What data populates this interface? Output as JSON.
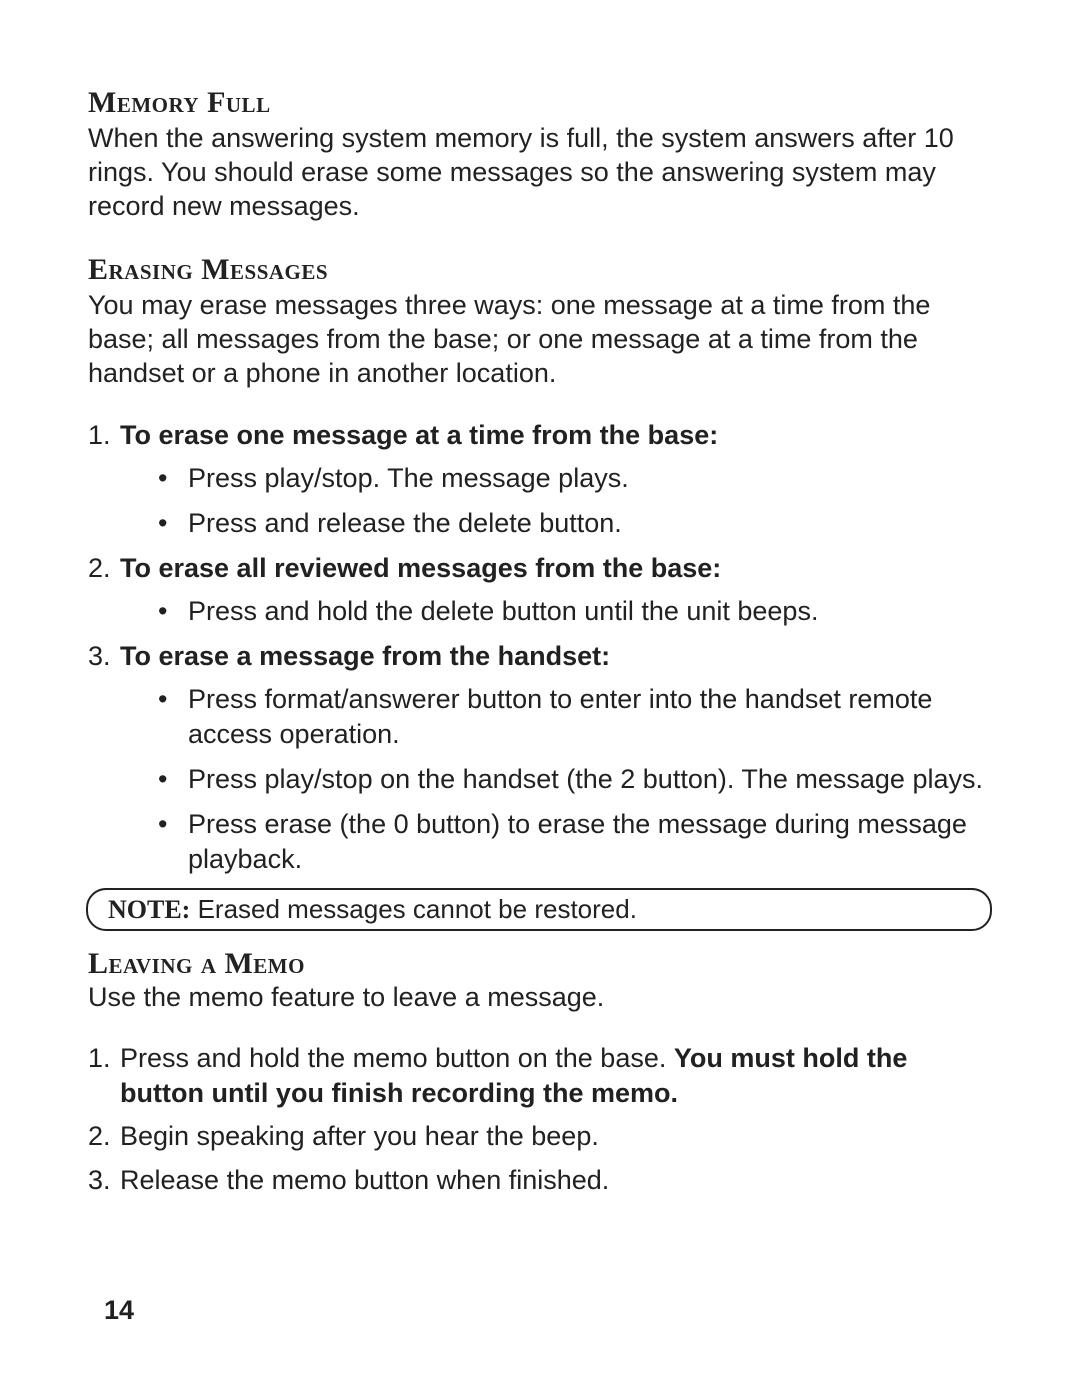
{
  "section1": {
    "heading": "Memory Full",
    "body": "When the answering system memory is full, the system answers after 10 rings. You should erase some messages so the answering system may record new messages."
  },
  "section2": {
    "heading": "Erasing Messages",
    "body": "You may erase messages three ways: one message at a time from the base; all messages from the base; or one message at a time from the handset or a phone in another location.",
    "items": [
      {
        "title": "To erase one message at a time from the base:",
        "bullets": [
          "Press play/stop. The message plays.",
          "Press and release the delete button."
        ]
      },
      {
        "title": "To erase all reviewed messages from the base:",
        "bullets": [
          "Press and hold the delete button until the unit beeps."
        ]
      },
      {
        "title": "To erase a message from the handset:",
        "bullets": [
          "Press format/answerer button to enter into the handset remote access operation.",
          "Press play/stop on the handset (the 2 button). The message plays.",
          "Press erase (the 0 button) to erase the message during message playback."
        ]
      }
    ],
    "note_label": "NOTE:",
    "note_text": " Erased messages cannot be restored."
  },
  "section3": {
    "heading": "Leaving a Memo",
    "body": "Use the memo feature to leave a message.",
    "items": [
      {
        "lead": "Press and hold the memo button on the base. ",
        "bold": "You must hold the button until you finish recording the memo."
      },
      {
        "lead": "Begin speaking after you hear the beep.",
        "bold": ""
      },
      {
        "lead": "Release the memo button when finished.",
        "bold": ""
      }
    ]
  },
  "page_number": "14"
}
